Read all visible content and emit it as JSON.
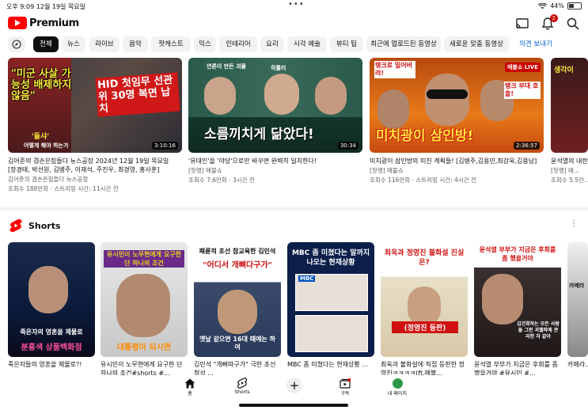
{
  "status": {
    "time_date": "오후 9:09 12월 19일 목요일",
    "dots": "•••",
    "battery_text": "44%",
    "battery_level": 0.44
  },
  "app": {
    "logo_text": "Premium",
    "notifications": "2"
  },
  "chips": [
    "전체",
    "뉴스",
    "라이브",
    "음악",
    "팟캐스트",
    "믹스",
    "인테리어",
    "요리",
    "시각 예술",
    "뷰티 팁",
    "최근에 업로드된 동영상",
    "새로운 맞춤 동영상",
    "의견 보내기"
  ],
  "videos": [
    {
      "title": "김어준의 겸손은힘들다 뉴스공장 2024년 12월 19일 목요일 [장경태, 박선원, 김병주, 이재석, 주진우, 최경영, 홍사훈]",
      "channel": "김어준의 겸손은힘들다 뉴스공장",
      "meta": "조회수 188만회 · 스트리밍 시간: 11시간 전",
      "duration": "3:10:16",
      "overlay1": "\"미군 사살 가능성 배제하지 않음\"",
      "overlay2": "HID 첫임무 선관위 30명 복면 납치",
      "overlay3": "'돌샤'",
      "overlay4": "어떻게 해야 하는가"
    },
    {
      "title": "'유대인'을 '야당'으로만 바꾸면 완벽히 일치한다!",
      "channel": "[핫행] 매불쇼",
      "meta": "조회수 7.6만회 · 3시간 전",
      "duration": "30:34",
      "overlay1": "소름끼치게 닮았다!",
      "overlay2": "연론이 만든 괴물",
      "overlay3": "히틀러"
    },
    {
      "title": "미치광이 삼인방의 미친 계획들! [김병주,김용민,최강욱,김용남]",
      "channel": "[핫행] 매불쇼",
      "meta": "조회수 116만회 · 스트리밍 시간: 4시간 전",
      "duration": "2:36:57",
      "overlay1": "미치광이 삼인방!",
      "overlay2": "탱크로 밀어버려!",
      "overlay3": "탱크 부대 호출!",
      "live": "매불쇼 LIVE"
    },
    {
      "title": "윤석열의 내란...",
      "channel": "[핫행] 매...",
      "meta": "조회수 5.5만...",
      "overlay1": "생각이"
    }
  ],
  "shorts": {
    "label": "Shorts",
    "items": [
      {
        "title": "죽은자들의 영혼을 제물로?!",
        "overlay1": "죽은자의 영혼을 제물로",
        "overlay2": "분홍색 상품백화점"
      },
      {
        "title": "유시민이 노무현에게 요구한 단 하나의 조건#shorts #...",
        "overlay1": "유시민이 노무현에게 요구한 단 하나의 조건",
        "overlay2": "대통령이 되시면"
      },
      {
        "title": "김민석 \"개뻐따구가\" 극한 초선 청성 ...",
        "overlay1": "패륜적 초선 참교육한 김민석",
        "overlay2": "\"어디서 개뼈다구가\"",
        "overlay3": "옛날 같으면 16대 때에는 하여"
      },
      {
        "title": "MBC 좀 미쳤다는 현재상황 ...",
        "overlay1": "MBC 좀 미쳤다는 말까지 나오는 현재상황",
        "overlay2": "MBC"
      },
      {
        "title": "최욱과 불화설에 직접 등판한 정영진ㅋㅋㅋㅋ(ft.매불...",
        "overlay1": "최욱과 정영진 불화설 진실은?",
        "overlay2": "(정영진 등판)"
      },
      {
        "title": "윤석열 부부가 지금은 후회를 좀 했을거야 #유시민 #...",
        "overlay1": "윤석열 부부가 지금은 후회를 좀 했을거야",
        "overlay2": "김건희하는 모든 사람들 그런 괴벨파에 관리한 자 같아"
      },
      {
        "title": "카메라...",
        "overlay1": "카메라"
      }
    ]
  },
  "nav": [
    {
      "label": "홈"
    },
    {
      "label": "Shorts"
    },
    {
      "label": ""
    },
    {
      "label": "구독"
    },
    {
      "label": "내 페이지"
    }
  ]
}
